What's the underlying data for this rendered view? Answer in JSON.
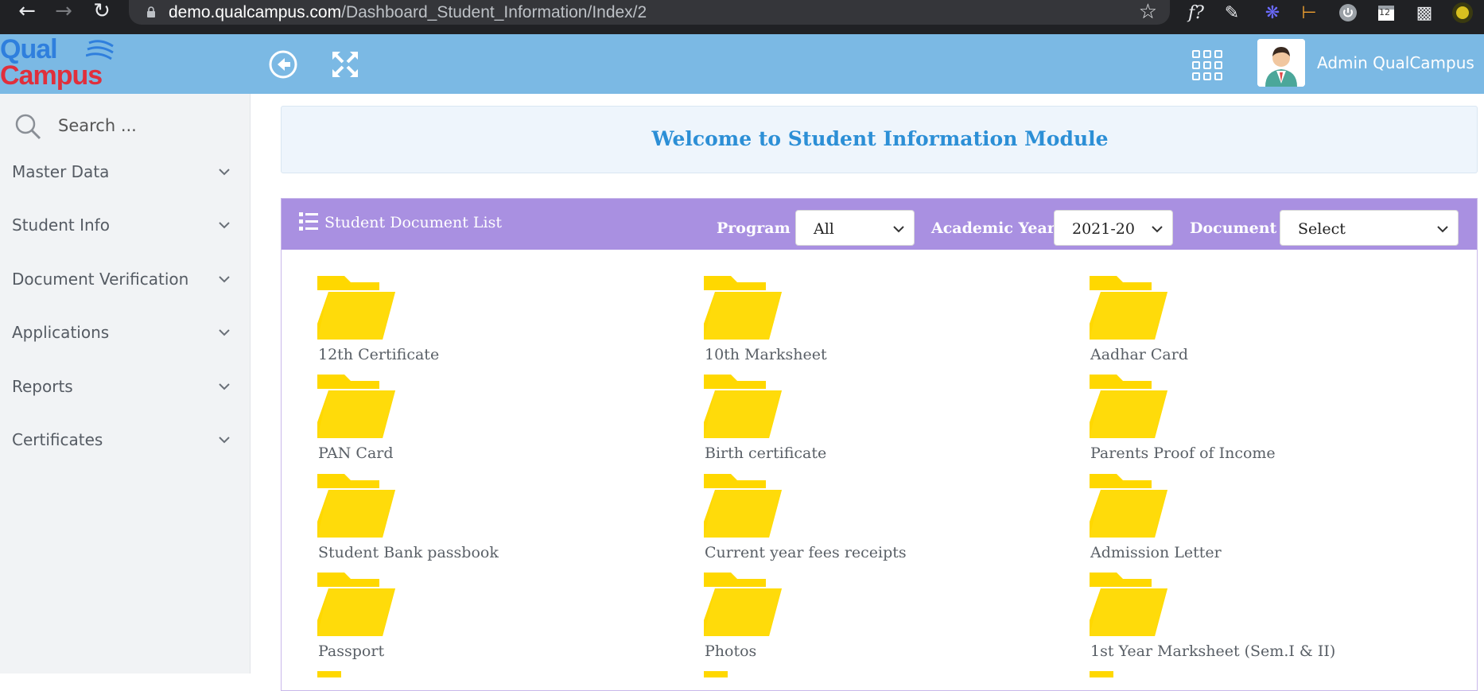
{
  "browser": {
    "url_host": "demo.qualcampus.com",
    "url_path": "/Dashboard_Student_Information/Index/2",
    "extension_badge": "12"
  },
  "header": {
    "logo_line1": "Qual",
    "logo_line2": "Campus",
    "user_name": "Admin QualCampus"
  },
  "sidebar": {
    "search_placeholder": "Search ...",
    "items": [
      {
        "label": "Master Data"
      },
      {
        "label": "Student Info"
      },
      {
        "label": "Document Verification"
      },
      {
        "label": "Applications"
      },
      {
        "label": "Reports"
      },
      {
        "label": "Certificates"
      }
    ]
  },
  "main": {
    "welcome": "Welcome to Student Information Module",
    "panel_title": "Student Document List",
    "filters": {
      "program_label": "Program",
      "program_value": "All",
      "year_label": "Academic Year",
      "year_value": "2021-20",
      "document_label": "Document",
      "document_value": "Select"
    },
    "folders": [
      {
        "label": "12th Certificate"
      },
      {
        "label": "10th Marksheet"
      },
      {
        "label": "Aadhar Card"
      },
      {
        "label": "PAN Card"
      },
      {
        "label": "Birth certificate"
      },
      {
        "label": "Parents Proof of Income"
      },
      {
        "label": "Student Bank passbook"
      },
      {
        "label": "Current year fees receipts"
      },
      {
        "label": "Admission Letter"
      },
      {
        "label": "Passport"
      },
      {
        "label": "Photos"
      },
      {
        "label": "1st Year Marksheet (Sem.I & II)"
      }
    ]
  },
  "colors": {
    "header": "#7bb9e4",
    "panel_header": "#a990e1",
    "folder": "#ffd800",
    "welcome_text": "#2c8fd6"
  }
}
